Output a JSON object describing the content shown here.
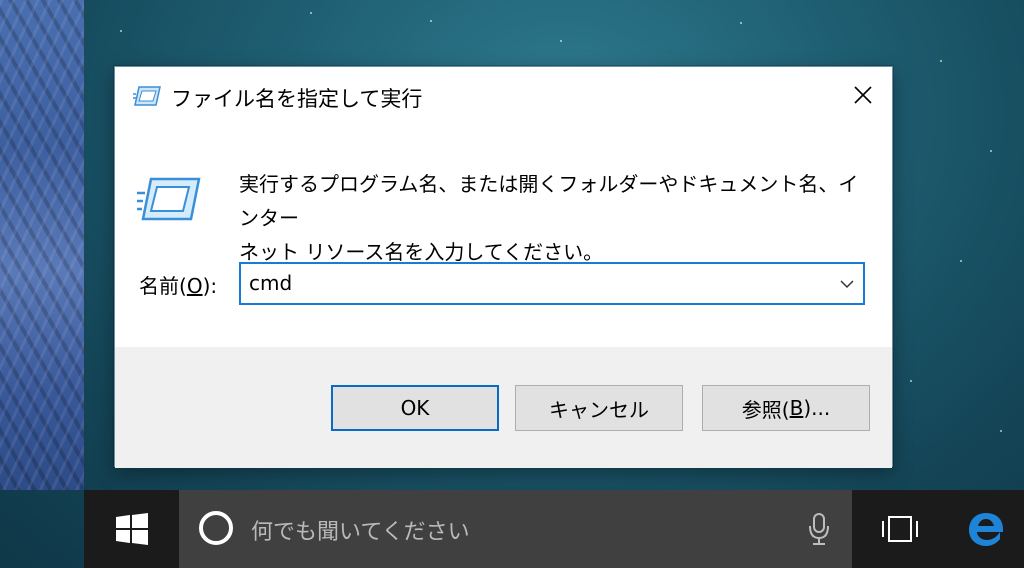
{
  "dialog": {
    "title": "ファイル名を指定して実行",
    "description_line1": "実行するプログラム名、または開くフォルダーやドキュメント名、インター",
    "description_line2": "ネット リソース名を入力してください。",
    "name_label_prefix": "名前(",
    "name_label_accel": "O",
    "name_label_suffix": "):",
    "input_value": "cmd",
    "buttons": {
      "ok": "OK",
      "cancel": "キャンセル",
      "browse_prefix": "参照(",
      "browse_accel": "B",
      "browse_suffix": ")..."
    },
    "icons": {
      "title": "run-icon",
      "large": "run-icon",
      "close": "close-icon",
      "dropdown": "chevron-down-icon"
    }
  },
  "taskbar": {
    "search_placeholder": "何でも聞いてください",
    "icons": {
      "start": "windows-logo-icon",
      "cortana": "cortana-icon",
      "mic": "microphone-icon",
      "task_view": "task-view-icon",
      "edge": "edge-icon"
    }
  },
  "colors": {
    "accent": "#0a6bc7",
    "taskbar": "#1b1b1b",
    "search_box": "#404040",
    "edge": "#1e84d8"
  }
}
